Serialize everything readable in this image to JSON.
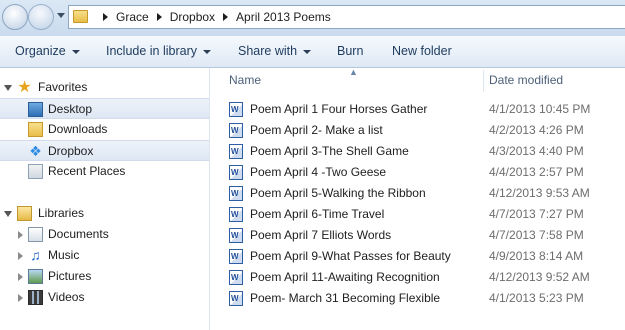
{
  "address": {
    "crumbs": [
      "Grace",
      "Dropbox",
      "April 2013 Poems"
    ]
  },
  "toolbar": {
    "organize": "Organize",
    "include_in_library": "Include in library",
    "share_with": "Share with",
    "burn": "Burn",
    "new_folder": "New folder"
  },
  "nav": {
    "favorites": "Favorites",
    "desktop": "Desktop",
    "downloads": "Downloads",
    "dropbox": "Dropbox",
    "recent_places": "Recent Places",
    "libraries": "Libraries",
    "documents": "Documents",
    "music": "Music",
    "pictures": "Pictures",
    "videos": "Videos"
  },
  "columns": {
    "name": "Name",
    "date_modified": "Date modified"
  },
  "files": [
    {
      "name": "Poem April 1 Four Horses Gather",
      "date": "4/1/2013 10:45 PM"
    },
    {
      "name": "Poem April 2- Make a list",
      "date": "4/2/2013 4:26 PM"
    },
    {
      "name": "Poem April 3-The Shell Game",
      "date": "4/3/2013 4:40 PM"
    },
    {
      "name": "Poem April 4 -Two Geese",
      "date": "4/4/2013 2:57 PM"
    },
    {
      "name": "Poem April 5-Walking the Ribbon",
      "date": "4/12/2013 9:53 AM"
    },
    {
      "name": "Poem April 6-Time Travel",
      "date": "4/7/2013 7:27 PM"
    },
    {
      "name": "Poem April 7 Elliots Words",
      "date": "4/7/2013 7:58 PM"
    },
    {
      "name": "Poem April 9-What Passes for Beauty",
      "date": "4/9/2013 8:14 AM"
    },
    {
      "name": "Poem April 11-Awaiting Recognition",
      "date": "4/12/2013 9:52 AM"
    },
    {
      "name": "Poem- March 31 Becoming Flexible",
      "date": "4/1/2013 5:23 PM"
    }
  ],
  "icons": {
    "doc_letter": "W"
  }
}
